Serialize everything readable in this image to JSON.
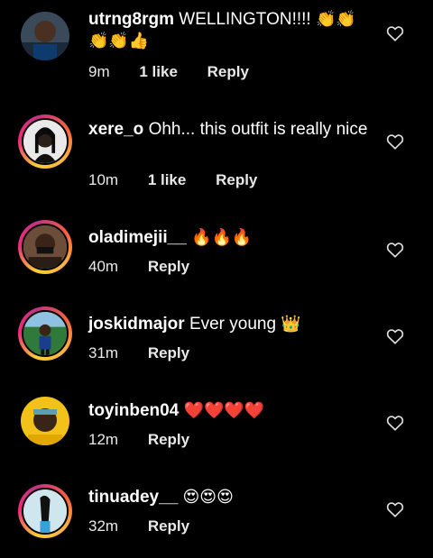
{
  "comments": [
    {
      "username": "utrng8rgm",
      "text": "WELLINGTON!!!!",
      "emoji": "👏👏👏👏👍",
      "time": "9m",
      "likes": "1 like",
      "reply": "Reply"
    },
    {
      "username": "xere_o",
      "text": "Ohh... this outfit is really nice",
      "emoji": "",
      "time": "10m",
      "likes": "1 like",
      "reply": "Reply"
    },
    {
      "username": "oladimejii__",
      "text": "",
      "emoji": "🔥🔥🔥",
      "time": "40m",
      "likes": "",
      "reply": "Reply"
    },
    {
      "username": "joskidmajor",
      "text": "Ever young",
      "emoji": "👑",
      "time": "31m",
      "likes": "",
      "reply": "Reply"
    },
    {
      "username": "toyinben04",
      "text": "",
      "emoji": "❤️❤️❤️❤️",
      "time": "12m",
      "likes": "",
      "reply": "Reply"
    },
    {
      "username": "tinuadey__",
      "text": "",
      "emoji": "😍😍😍",
      "time": "32m",
      "likes": "",
      "reply": "Reply"
    }
  ],
  "icons": {
    "like": "heart-outline-icon"
  },
  "colors": {
    "background": "#000000",
    "text": "#ffffff",
    "story_ring": "#ee2a7b"
  }
}
